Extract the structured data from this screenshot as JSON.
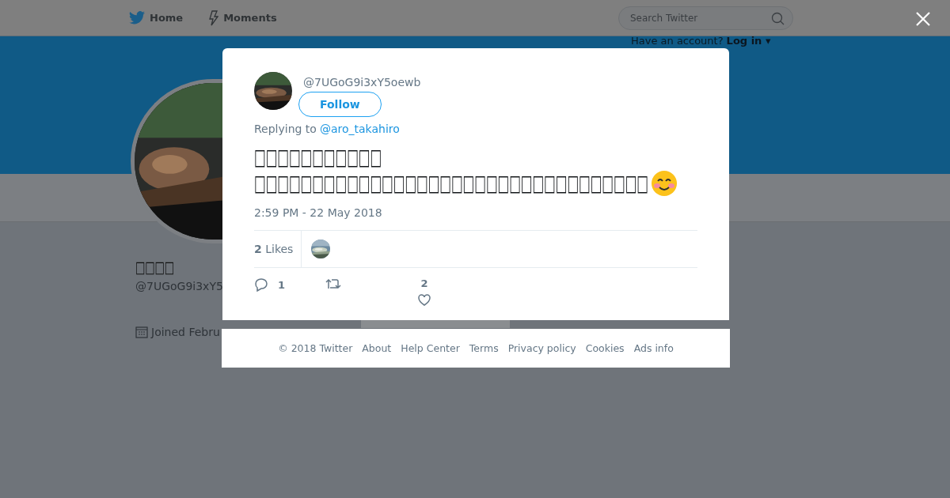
{
  "nav": {
    "items": [
      {
        "label": "Home",
        "kind": "bird"
      },
      {
        "label": "Moments",
        "kind": "bolt"
      }
    ],
    "search": {
      "placeholder": "Search Twitter"
    },
    "login_prompt": "Have an account?",
    "login_link": "Log in ▾"
  },
  "profile": {
    "name": "□□□□",
    "handle": "@7UGoG9i3xY5",
    "joined": "Joined Febru"
  },
  "tweet": {
    "handle": "@7UGoG9i3xY5oewb",
    "follow": "Follow",
    "replying_label": "Replying to",
    "replying_to": "@aro_takahiro",
    "lines": [
      "□□□□□□□□□□□",
      "□□□□□□□□□□□□□□□□□□□□□□□□□□□□□□□□□□"
    ],
    "time": "2:59 PM - 22 May 2018",
    "likes_count": "2",
    "likes_label": "Likes",
    "actions": [
      {
        "kind": "reply",
        "count": "1"
      },
      {
        "kind": "retweet"
      },
      {
        "kind": "like",
        "count": "2"
      }
    ]
  },
  "footer": [
    "© 2018 Twitter",
    "About",
    "Help Center",
    "Terms",
    "Privacy policy",
    "Cookies",
    "Ads info"
  ]
}
